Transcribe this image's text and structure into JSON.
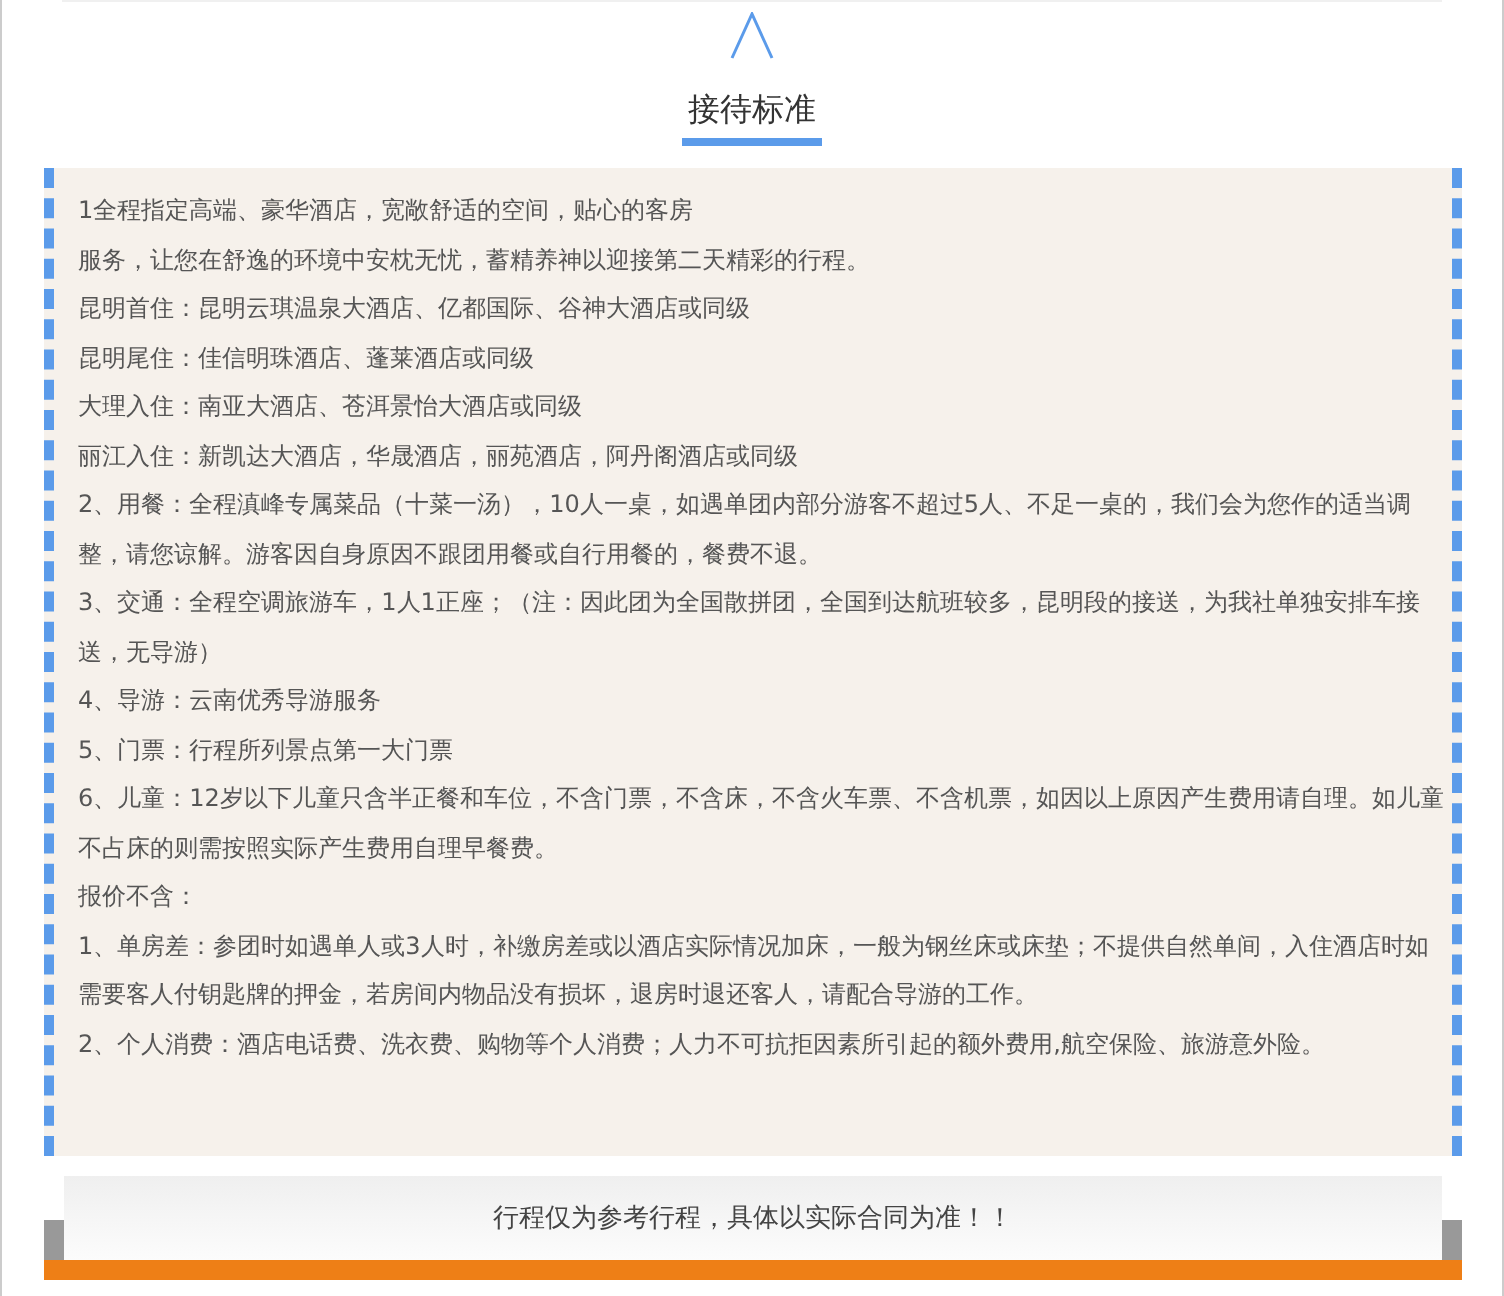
{
  "section_title": "接待标准",
  "paragraphs": [
    "1全程指定高端、豪华酒店，宽敞舒适的空间，贴心的客房",
    "服务，让您在舒逸的环境中安枕无忧，蓄精养神以迎接第二天精彩的行程。",
    "昆明首住：昆明云琪温泉大酒店、亿都国际、谷神大酒店或同级",
    "昆明尾住：佳信明珠酒店、蓬莱酒店或同级",
    "大理入住：南亚大酒店、苍洱景怡大酒店或同级",
    "丽江入住：新凯达大酒店，华晟酒店，丽苑酒店，阿丹阁酒店或同级",
    "2、用餐：全程滇峰专属菜品（十菜一汤），10人一桌，如遇单团内部分游客不超过5人、不足一桌的，我们会为您作的适当调整，请您谅解。游客因自身原因不跟团用餐或自行用餐的，餐费不退。",
    "3、交通：全程空调旅游车，1人1正座；（注：因此团为全国散拼团，全国到达航班较多，昆明段的接送，为我社单独安排车接送，无导游）",
    "4、导游：云南优秀导游服务",
    "5、门票：行程所列景点第一大门票",
    "6、儿童：12岁以下儿童只含半正餐和车位，不含门票，不含床，不含火车票、不含机票，如因以上原因产生费用请自理。如儿童不占床的则需按照实际产生费用自理早餐费。",
    "报价不含：",
    "1、单房差：参团时如遇单人或3人时，补缴房差或以酒店实际情况加床，一般为钢丝床或床垫；不提供自然单间，入住酒店时如需要客人付钥匙牌的押金，若房间内物品没有损坏，退房时退还客人，请配合导游的工作。",
    "2、个人消费：酒店电话费、洗衣费、购物等个人消费；人力不可抗拒因素所引起的额外费用,航空保险、旅游意外险。"
  ],
  "footer_note": "行程仅为参考行程，具体以实际合同为准！！"
}
